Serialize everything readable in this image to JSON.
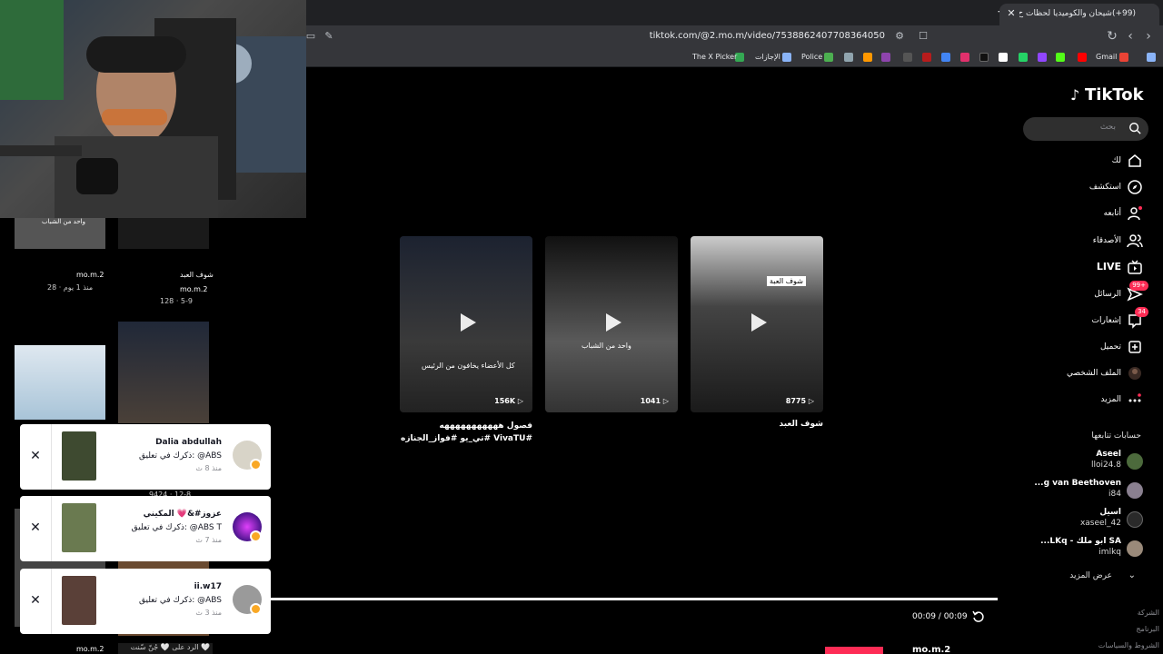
{
  "browser": {
    "tab_title": "(99+)شيحان والكوميديا لحظات ح...",
    "url": "tiktok.com/@2.mo.m/video/7538862407708364050",
    "bookmarks": [
      {
        "label": "Gmail",
        "color": "#ea4335"
      },
      {
        "label": "Police",
        "color": "#4caf50"
      },
      {
        "label": "الإجازات",
        "color": "#8ab4f8"
      },
      {
        "label": "The X Picker",
        "color": "#34a853"
      }
    ]
  },
  "tiktok": {
    "logo": "TikTok",
    "search_placeholder": "بحث",
    "nav": [
      {
        "label": "لك",
        "icon": "home-icon"
      },
      {
        "label": "استكشف",
        "icon": "compass-icon"
      },
      {
        "label": "أتابعه",
        "icon": "user-plus-icon"
      },
      {
        "label": "الأصدقاء",
        "icon": "friends-icon"
      },
      {
        "label": "LIVE",
        "icon": "live-icon"
      },
      {
        "label": "الرسائل",
        "icon": "message-icon",
        "badge": "99+"
      },
      {
        "label": "إشعارات",
        "icon": "inbox-icon",
        "badge": "34"
      },
      {
        "label": "تحميل",
        "icon": "upload-icon"
      },
      {
        "label": "الملف الشخصي",
        "icon": "profile-icon"
      },
      {
        "label": "المزيد",
        "icon": "more-icon"
      }
    ],
    "following_title": "حسابات تتابعها",
    "following": [
      {
        "name": "Aseel",
        "handle": "lloi24.8"
      },
      {
        "name": "...g van Beethoven",
        "handle": "i84"
      },
      {
        "name": "اسيل",
        "handle": "xaseel_42"
      },
      {
        "name": "...LKq - ابو ملك SA",
        "handle": "imlkq"
      }
    ],
    "see_more": "عرض المزيد",
    "footer": [
      "الشركة",
      "البرنامج",
      "الشروط والسياسات"
    ]
  },
  "videos": [
    {
      "views": "156K",
      "caption": "كل الأعضاء يخافون من الرئيس",
      "title": "فصول هههههههههههه #VivaTU #تي_يو #فواز_الجنازه"
    },
    {
      "views": "1041",
      "caption": "واحد من الشباب",
      "title": ""
    },
    {
      "views": "8775",
      "caption": "شوف العبة",
      "title": "شوف العبد"
    }
  ],
  "left_grid": {
    "items": [
      {
        "caption": "واحد من الشباب",
        "user": "mo.m.2",
        "meta": "28 · منذ 1 يوم"
      },
      {
        "caption": "شوف العبد",
        "user": "mo.m.2",
        "meta": "128 · 5-9"
      }
    ],
    "row3_meta": "9424 · 12-8",
    "bottom_user": "mo.m.2",
    "bottom_reply": "الرد على 🤍 جُنّ سّنت 🤍"
  },
  "notifications": [
    {
      "name": "Dalia abdullah",
      "text": "ذكرك في تعليق: @ABS",
      "time": "منذ 8 ث"
    },
    {
      "name": "عزوز#&💗 المكيني",
      "text": "ذكرك في تعليق: @ABS T",
      "time": "منذ 7 ث"
    },
    {
      "name": "ii.w17",
      "text": "ذكرك في تعليق: @ABS",
      "time": "منذ 3 ث"
    }
  ],
  "player": {
    "time": "00:09 / 00:09",
    "bottom_name": "mo.m.2"
  },
  "colors": {
    "accent": "#fe2c55",
    "badge_gold": "#f9a825"
  }
}
